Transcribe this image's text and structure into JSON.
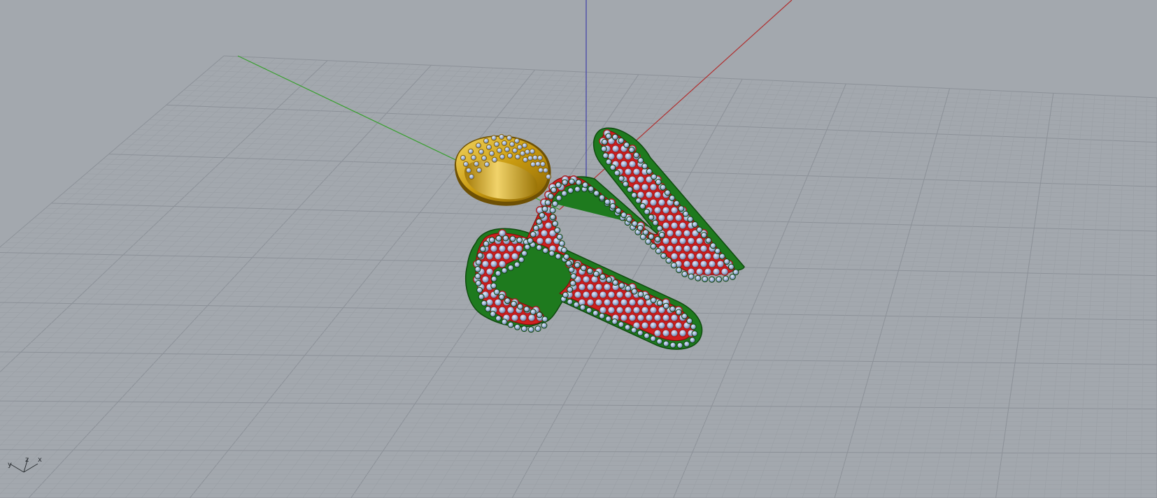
{
  "viewport": {
    "background_color": "#a3a8ae",
    "grid_minor_color": "#9a9fa5",
    "grid_major_color": "#8c9198",
    "x_axis_color": "#b03030",
    "y_axis_color": "#3aa030",
    "z_axis_color": "#4040a8"
  },
  "axis_gizmo": {
    "x_label": "x",
    "y_label": "y",
    "z_label": "z"
  },
  "model": {
    "letter_fill_color": "#d02020",
    "letter_rim_color": "#1e7a1e",
    "bail_color": "#c89a10",
    "gem_color": "#9fb3d8"
  }
}
